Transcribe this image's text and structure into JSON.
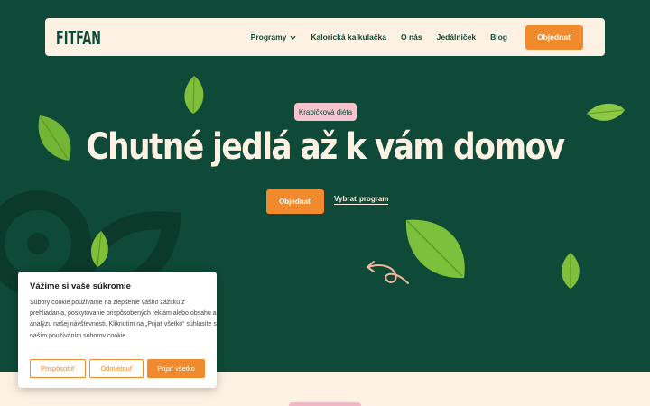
{
  "nav": {
    "logo_text": "FITFAN",
    "links": [
      "Programy",
      "Kalorická kalkulačka",
      "O nás",
      "Jedálniček",
      "Blog"
    ],
    "cta": "Objednať"
  },
  "hero": {
    "tag": "Krabičková diéta",
    "title": "Chutné jedlá až k vám domov",
    "primary_cta": "Objednať",
    "secondary_link": "Vybrať program"
  },
  "cookie": {
    "title": "Vážime si vaše súkromie",
    "text": "Súbory cookie používame na zlepšenie vášho zážitku z prehliadania, poskytovanie prispôsobených reklám alebo obsahu a analýzu našej návštevnosti. Kliknutím na „Prijať všetko“ súhlasíte s naším používaním súborov cookie.",
    "customize": "Prispôsobiť",
    "reject": "Odmietnuť",
    "accept": "Prijať všetko"
  },
  "colors": {
    "hero_bg": "#0e4a37",
    "accent": "#f08a2c",
    "cream": "#fdf1e4",
    "tag_pink": "#f5c4cf"
  },
  "icons": [
    "chevron-down-icon",
    "basil-leaf-icon",
    "curly-arrow-icon"
  ]
}
